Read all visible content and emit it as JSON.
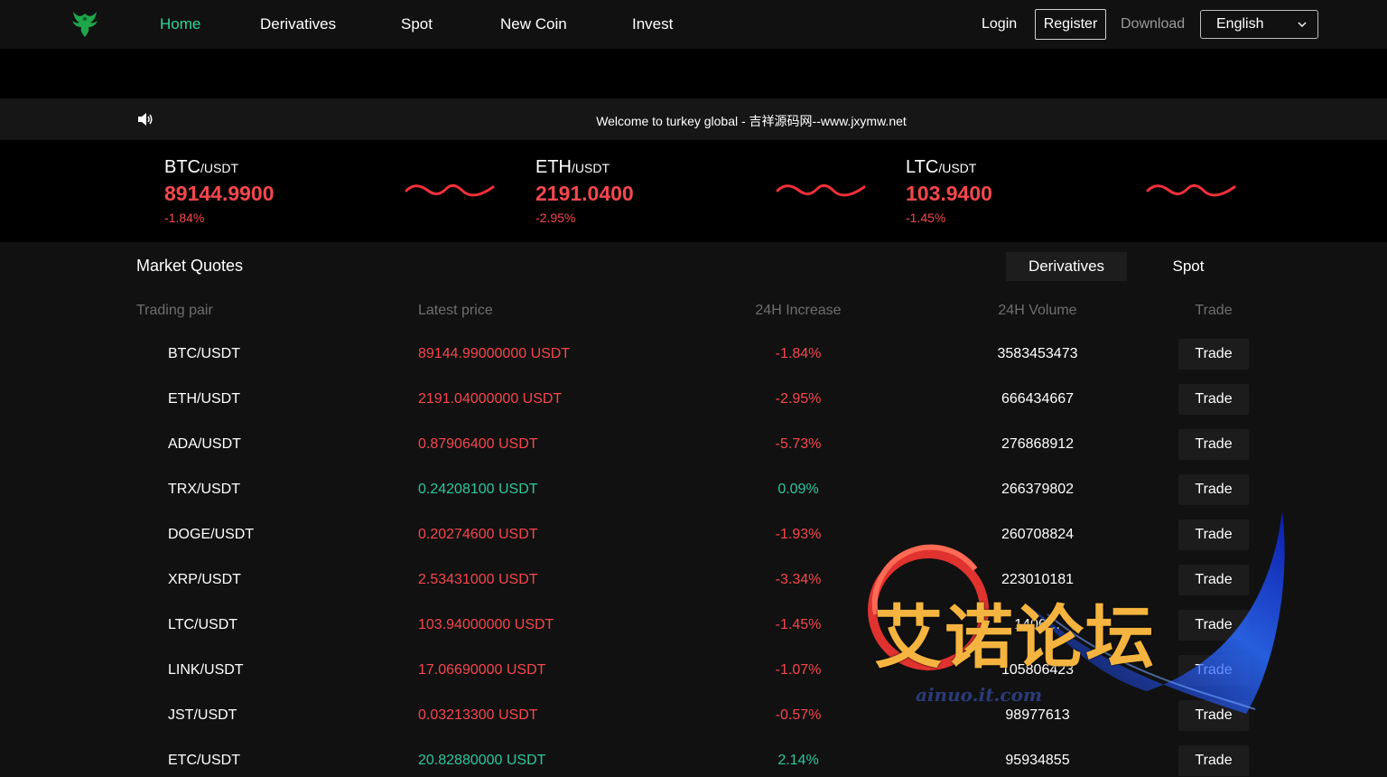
{
  "header": {
    "nav": [
      {
        "label": "Home",
        "active": true
      },
      {
        "label": "Derivatives",
        "active": false
      },
      {
        "label": "Spot",
        "active": false
      },
      {
        "label": "New Coin",
        "active": false
      },
      {
        "label": "Invest",
        "active": false
      }
    ],
    "login": "Login",
    "register": "Register",
    "download": "Download",
    "language": "English"
  },
  "notice": {
    "icon": "speaker-icon",
    "text": "Welcome to turkey global - 吉祥源码网--www.jxymw.net"
  },
  "ticker": [
    {
      "base": "BTC",
      "quote": "/USDT",
      "price": "89144.9900",
      "change": "-1.84%"
    },
    {
      "base": "ETH",
      "quote": "/USDT",
      "price": "2191.0400",
      "change": "-2.95%"
    },
    {
      "base": "LTC",
      "quote": "/USDT",
      "price": "103.9400",
      "change": "-1.45%"
    }
  ],
  "market": {
    "title": "Market Quotes",
    "tabs": [
      {
        "label": "Derivatives",
        "active": true
      },
      {
        "label": "Spot",
        "active": false
      }
    ],
    "columns": [
      "Trading pair",
      "Latest price",
      "24H Increase",
      "24H Volume",
      "Trade"
    ],
    "rows": [
      {
        "pair": "BTC/USDT",
        "price": "89144.99000000 USDT",
        "change": "-1.84%",
        "volume": "3583453473",
        "trade": "Trade",
        "dir": "down"
      },
      {
        "pair": "ETH/USDT",
        "price": "2191.04000000 USDT",
        "change": "-2.95%",
        "volume": "666434667",
        "trade": "Trade",
        "dir": "down"
      },
      {
        "pair": "ADA/USDT",
        "price": "0.87906400 USDT",
        "change": "-5.73%",
        "volume": "276868912",
        "trade": "Trade",
        "dir": "down"
      },
      {
        "pair": "TRX/USDT",
        "price": "0.24208100 USDT",
        "change": "0.09%",
        "volume": "266379802",
        "trade": "Trade",
        "dir": "up"
      },
      {
        "pair": "DOGE/USDT",
        "price": "0.20274600 USDT",
        "change": "-1.93%",
        "volume": "260708824",
        "trade": "Trade",
        "dir": "down"
      },
      {
        "pair": "XRP/USDT",
        "price": "2.53431000 USDT",
        "change": "-3.34%",
        "volume": "223010181",
        "trade": "Trade",
        "dir": "down"
      },
      {
        "pair": "LTC/USDT",
        "price": "103.94000000 USDT",
        "change": "-1.45%",
        "volume": "1406…",
        "trade": "Trade",
        "dir": "down"
      },
      {
        "pair": "LINK/USDT",
        "price": "17.06690000 USDT",
        "change": "-1.07%",
        "volume": "105806423",
        "trade": "Trade",
        "dir": "down"
      },
      {
        "pair": "JST/USDT",
        "price": "0.03213300 USDT",
        "change": "-0.57%",
        "volume": "98977613",
        "trade": "Trade",
        "dir": "down"
      },
      {
        "pair": "ETC/USDT",
        "price": "20.82880000 USDT",
        "change": "2.14%",
        "volume": "95934855",
        "trade": "Trade",
        "dir": "up"
      }
    ]
  },
  "watermark": {
    "text": "艾诺论坛",
    "url": "ainuo.it.com"
  },
  "colors": {
    "accent": "#2bd5a0",
    "up": "#2bc89b",
    "down": "#f5474d",
    "background": "#111111"
  }
}
